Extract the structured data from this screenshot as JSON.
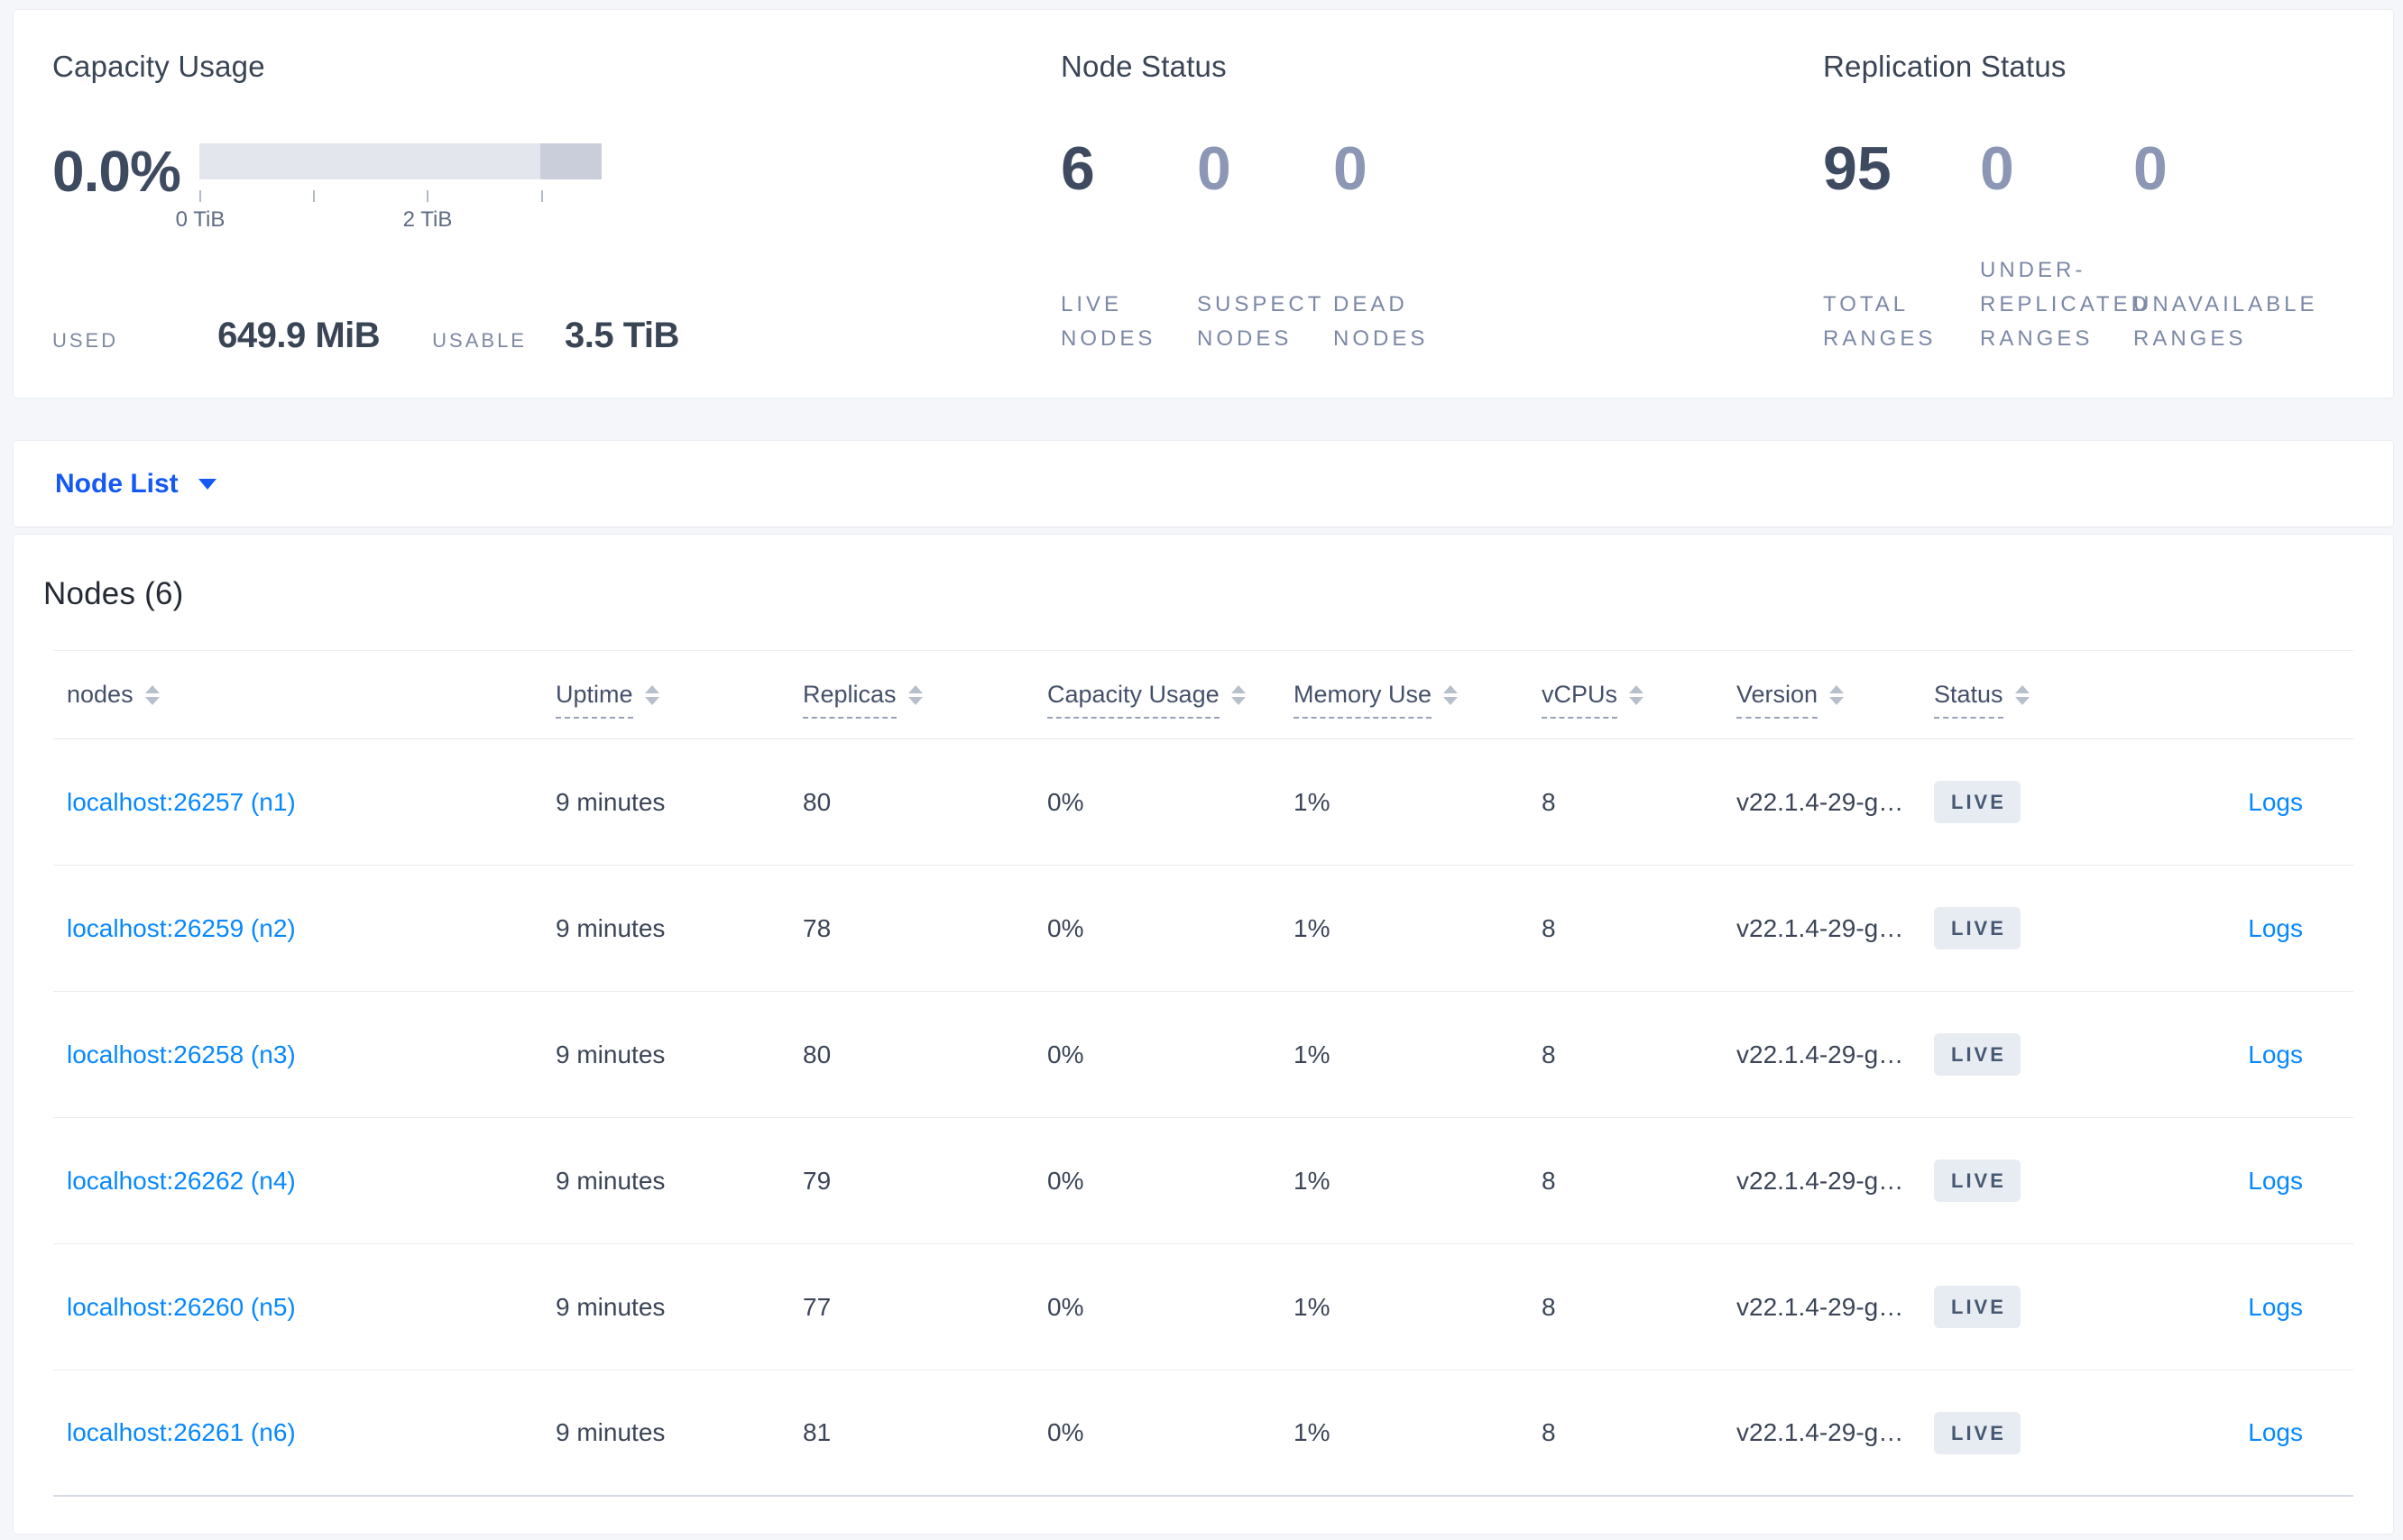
{
  "summary": {
    "capacity": {
      "title": "Capacity Usage",
      "percent": "0.0%",
      "tick_labels": [
        {
          "label": "0 TiB",
          "position_pct": 0
        },
        {
          "label": "2 TiB",
          "position_pct": 56.5
        }
      ],
      "used_label": "USED",
      "used_value": "649.9 MiB",
      "usable_label": "USABLE",
      "usable_value": "3.5 TiB"
    },
    "node_status": {
      "title": "Node Status",
      "stats": [
        {
          "value": "6",
          "label": "LIVE NODES"
        },
        {
          "value": "0",
          "label": "SUSPECT NODES"
        },
        {
          "value": "0",
          "label": "DEAD NODES"
        }
      ]
    },
    "replication_status": {
      "title": "Replication Status",
      "stats": [
        {
          "value": "95",
          "label": "TOTAL RANGES"
        },
        {
          "value": "0",
          "label": "UNDER-REPLICATED RANGES"
        },
        {
          "value": "0",
          "label": "UNAVAILABLE RANGES"
        }
      ]
    }
  },
  "view_selector": {
    "label": "Node List"
  },
  "nodes_section": {
    "title": "Nodes (6)",
    "columns": {
      "nodes": "nodes",
      "uptime": "Uptime",
      "replicas": "Replicas",
      "capacity": "Capacity Usage",
      "memory": "Memory Use",
      "vcpus": "vCPUs",
      "version": "Version",
      "status": "Status"
    },
    "rows": [
      {
        "address": "localhost:26257 (n1)",
        "uptime": "9 minutes",
        "replicas": "80",
        "capacity": "0%",
        "memory": "1%",
        "vcpus": "8",
        "version": "v22.1.4-29-g…",
        "status": "LIVE",
        "logs": "Logs"
      },
      {
        "address": "localhost:26259 (n2)",
        "uptime": "9 minutes",
        "replicas": "78",
        "capacity": "0%",
        "memory": "1%",
        "vcpus": "8",
        "version": "v22.1.4-29-g…",
        "status": "LIVE",
        "logs": "Logs"
      },
      {
        "address": "localhost:26258 (n3)",
        "uptime": "9 minutes",
        "replicas": "80",
        "capacity": "0%",
        "memory": "1%",
        "vcpus": "8",
        "version": "v22.1.4-29-g…",
        "status": "LIVE",
        "logs": "Logs"
      },
      {
        "address": "localhost:26262 (n4)",
        "uptime": "9 minutes",
        "replicas": "79",
        "capacity": "0%",
        "memory": "1%",
        "vcpus": "8",
        "version": "v22.1.4-29-g…",
        "status": "LIVE",
        "logs": "Logs"
      },
      {
        "address": "localhost:26260 (n5)",
        "uptime": "9 minutes",
        "replicas": "77",
        "capacity": "0%",
        "memory": "1%",
        "vcpus": "8",
        "version": "v22.1.4-29-g…",
        "status": "LIVE",
        "logs": "Logs"
      },
      {
        "address": "localhost:26261 (n6)",
        "uptime": "9 minutes",
        "replicas": "81",
        "capacity": "0%",
        "memory": "1%",
        "vcpus": "8",
        "version": "v22.1.4-29-g…",
        "status": "LIVE",
        "logs": "Logs"
      }
    ]
  },
  "colors": {
    "accent_blue": "#1459f2",
    "link_blue": "#0788ff",
    "bar_track": "#e3e6ed",
    "bar_dark_segment": "#c9ceda",
    "badge_bg": "#e7ebf2"
  }
}
